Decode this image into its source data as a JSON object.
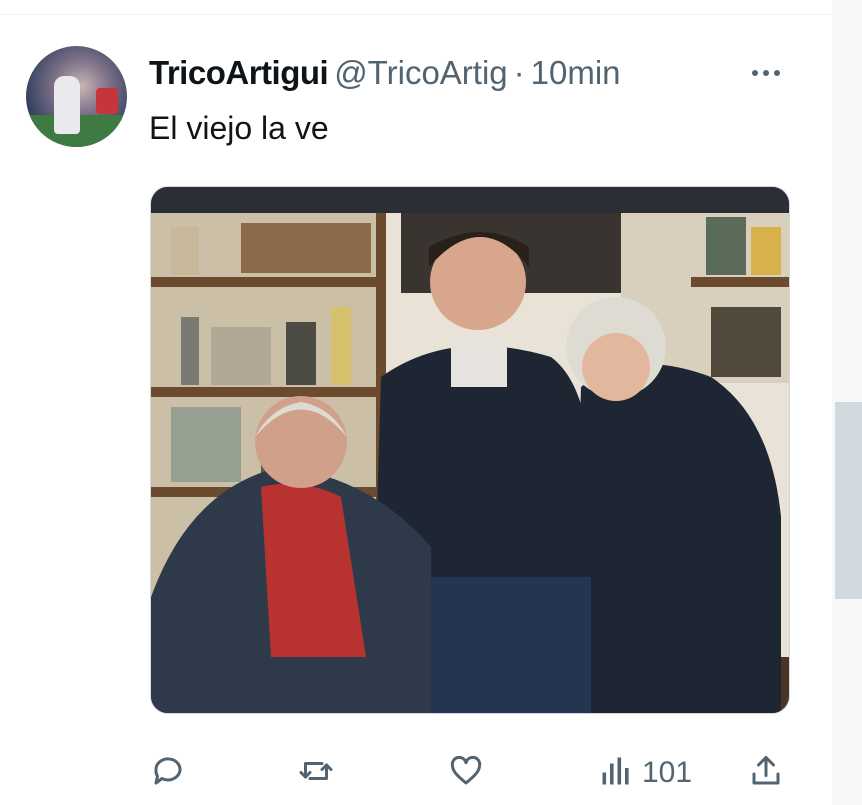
{
  "tweet": {
    "display_name": "TricoArtigui",
    "handle": "@TricoArtig",
    "separator": "·",
    "time": "10min",
    "more_icon": "more-horizontal-icon",
    "text": "El viejo la ve",
    "media": {
      "type": "photo",
      "colors": {
        "frame": "#2b2f35",
        "wall": "#e9e3d7",
        "shelf": "#6b4a2e",
        "jacket_dark": "#1f2633",
        "shirt_red": "#b8322f",
        "hair_white": "#dedbd2"
      }
    },
    "actions": {
      "reply_icon": "reply-icon",
      "retweet_icon": "retweet-icon",
      "like_icon": "heart-icon",
      "views_icon": "analytics-icon",
      "views_count": "101",
      "share_icon": "share-icon"
    }
  }
}
